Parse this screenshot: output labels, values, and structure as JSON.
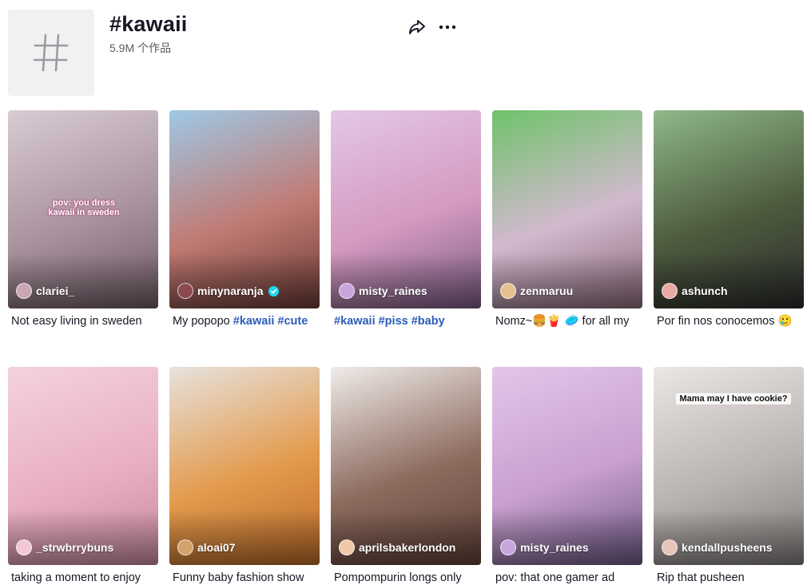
{
  "header": {
    "title": "#kawaii",
    "count": "5.9M",
    "count_label": "个作品",
    "share_icon": "share-arrow-icon",
    "more_icon": "more-dots-icon",
    "tag_icon": "hashtag-icon"
  },
  "videos": [
    {
      "user": "clariei_",
      "verified": false,
      "caption": "Not easy living in sweden",
      "tags": "",
      "overlay": "pov: you dress kawaii in sweden",
      "colors": [
        "#d9cbd3",
        "#a9939e",
        "#6e5a64"
      ],
      "avatar": "#c9a7b5"
    },
    {
      "user": "minynaranja",
      "verified": true,
      "caption": "My popopo ",
      "tags": "#kawaii #cute",
      "overlay": "",
      "colors": [
        "#9fc8e4",
        "#c07a74",
        "#6b3b35"
      ],
      "avatar": "#8a4a50"
    },
    {
      "user": "misty_raines",
      "verified": false,
      "caption": "",
      "tags": "#kawaii #piss #baby",
      "overlay": "",
      "colors": [
        "#e3c7e6",
        "#d59ac0",
        "#7a5c82"
      ],
      "avatar": "#c7a6dd"
    },
    {
      "user": "zenmaruu",
      "verified": false,
      "caption": "Nomz~🍔🍟 🥏 for all my",
      "tags": "",
      "overlay": "",
      "colors": [
        "#6fc36a",
        "#d2b9cf",
        "#8a6a7a"
      ],
      "avatar": "#e6c190"
    },
    {
      "user": "ashunch",
      "verified": false,
      "caption": "Por fin nos conocemos 🥲",
      "tags": "",
      "overlay": "",
      "colors": [
        "#8fb88a",
        "#4d5b3e",
        "#2b2b2b"
      ],
      "avatar": "#e9a9a5"
    },
    {
      "user": "_strwbrrybuns",
      "verified": false,
      "caption": "taking a moment to enjoy",
      "tags": "",
      "overlay": "",
      "colors": [
        "#f4d2de",
        "#e9b0c3",
        "#c98aa0"
      ],
      "avatar": "#f2c8d4"
    },
    {
      "user": "aloai07",
      "verified": false,
      "caption": "Funny baby fashion show",
      "tags": "",
      "overlay": "",
      "colors": [
        "#e7e2dd",
        "#e39a4c",
        "#b96a2a"
      ],
      "avatar": "#d1a26b"
    },
    {
      "user": "aprilsbakerlondon",
      "verified": false,
      "caption": "Pompompurin longs only",
      "tags": "",
      "overlay": "",
      "colors": [
        "#f0ece9",
        "#8d6b5f",
        "#5e4137"
      ],
      "avatar": "#f0c9a8"
    },
    {
      "user": "misty_raines",
      "verified": false,
      "caption": "pov: that one gamer ad",
      "tags": "",
      "overlay": "",
      "colors": [
        "#e2c6e9",
        "#c9a0cf",
        "#6e5a84"
      ],
      "avatar": "#c7a6dd"
    },
    {
      "user": "kendallpusheens",
      "verified": false,
      "caption": "Rip that pusheen",
      "tags": "",
      "overlay": "Mama may I have cookie?",
      "colors": [
        "#ebe7e5",
        "#b9b3b1",
        "#7f7a79"
      ],
      "avatar": "#e8c3b9"
    }
  ]
}
